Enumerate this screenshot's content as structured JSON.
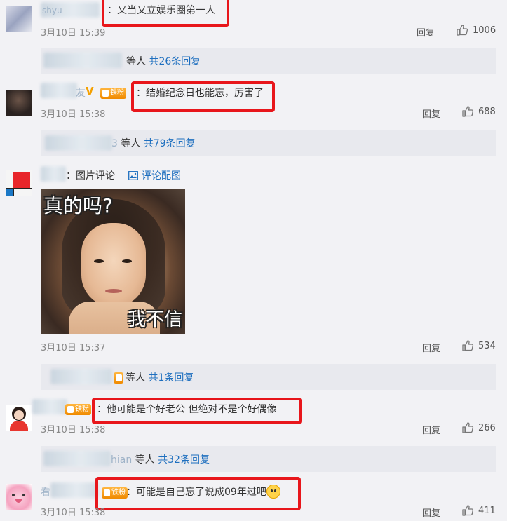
{
  "actions": {
    "reply_label": "回复"
  },
  "comments": [
    {
      "text": "：又当又立娱乐圈第一人",
      "date": "3月10日 15:39",
      "likes": "1006",
      "replies_suffix": "等人",
      "replies_link": "共26条回复",
      "name_partial": "shyu"
    },
    {
      "text": "：结婚纪念日也能忘，厉害了",
      "date": "3月10日 15:38",
      "likes": "688",
      "badge": "铁粉",
      "name_partial": "友",
      "replies_suffix": "等人",
      "replies_name_partial": "3",
      "replies_link": "共79条回复"
    },
    {
      "text": "：图片评论",
      "pic_link": "评论配图",
      "meme_top": "真的吗?",
      "meme_bottom": "我不信",
      "date": "3月10日 15:37",
      "likes": "534",
      "replies_suffix": "等人",
      "replies_link": "共1条回复"
    },
    {
      "text": "：他可能是个好老公 但绝对不是个好偶像",
      "date": "3月10日 15:38",
      "likes": "266",
      "badge": "铁粉",
      "replies_name_partial": "hian",
      "replies_suffix": "等人",
      "replies_link": "共32条回复"
    },
    {
      "text": "：可能是自己忘了说成09年过吧",
      "date": "3月10日 15:38",
      "likes": "411",
      "badge": "铁粉",
      "name_partial": "看"
    }
  ],
  "icons": {
    "like": "thumbs-up-icon",
    "picture": "image-icon",
    "emoji": "doge-emoji-icon"
  },
  "colors": {
    "link": "#1e6fbf",
    "highlight": "#e8161b",
    "badge": "#f08a00",
    "reply_background": "#e8e9ee"
  }
}
